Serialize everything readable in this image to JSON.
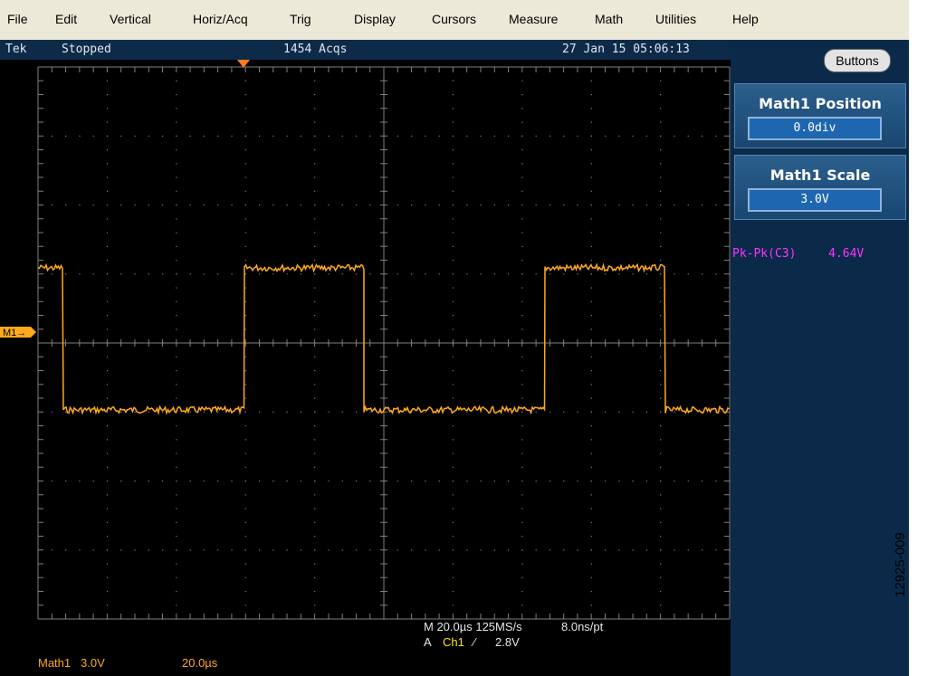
{
  "menu": {
    "items": [
      "File",
      "Edit",
      "Vertical",
      "Horiz/Acq",
      "Trig",
      "Display",
      "Cursors",
      "Measure",
      "Math",
      "Utilities",
      "Help"
    ]
  },
  "status": {
    "brand": "Tek",
    "state": "Stopped",
    "acqs": "1454 Acqs",
    "datetime": "27 Jan 15 05:06:13"
  },
  "screen": {
    "marker_label": "M1→",
    "trace_color": "#ffaa1e",
    "grid_color": "#808080"
  },
  "readout": {
    "horizontal_line1": "M 20.0µs 125MS/s",
    "sample_rate": "8.0ns/pt",
    "trigger_prefix": "A",
    "trigger_source": "Ch1",
    "trigger_slope": "⁄",
    "trigger_level": "2.8V",
    "math_label": "Math1",
    "math_scale": "3.0V",
    "math_time": "20.0µs"
  },
  "panel": {
    "buttons_label": "Buttons",
    "position_title": "Math1 Position",
    "position_value": "0.0div",
    "scale_title": "Math1 Scale",
    "scale_value": "3.0V",
    "measurement_label": "Pk-Pk(C3)",
    "measurement_value": "4.64V"
  },
  "figure_id": "12925-009"
}
